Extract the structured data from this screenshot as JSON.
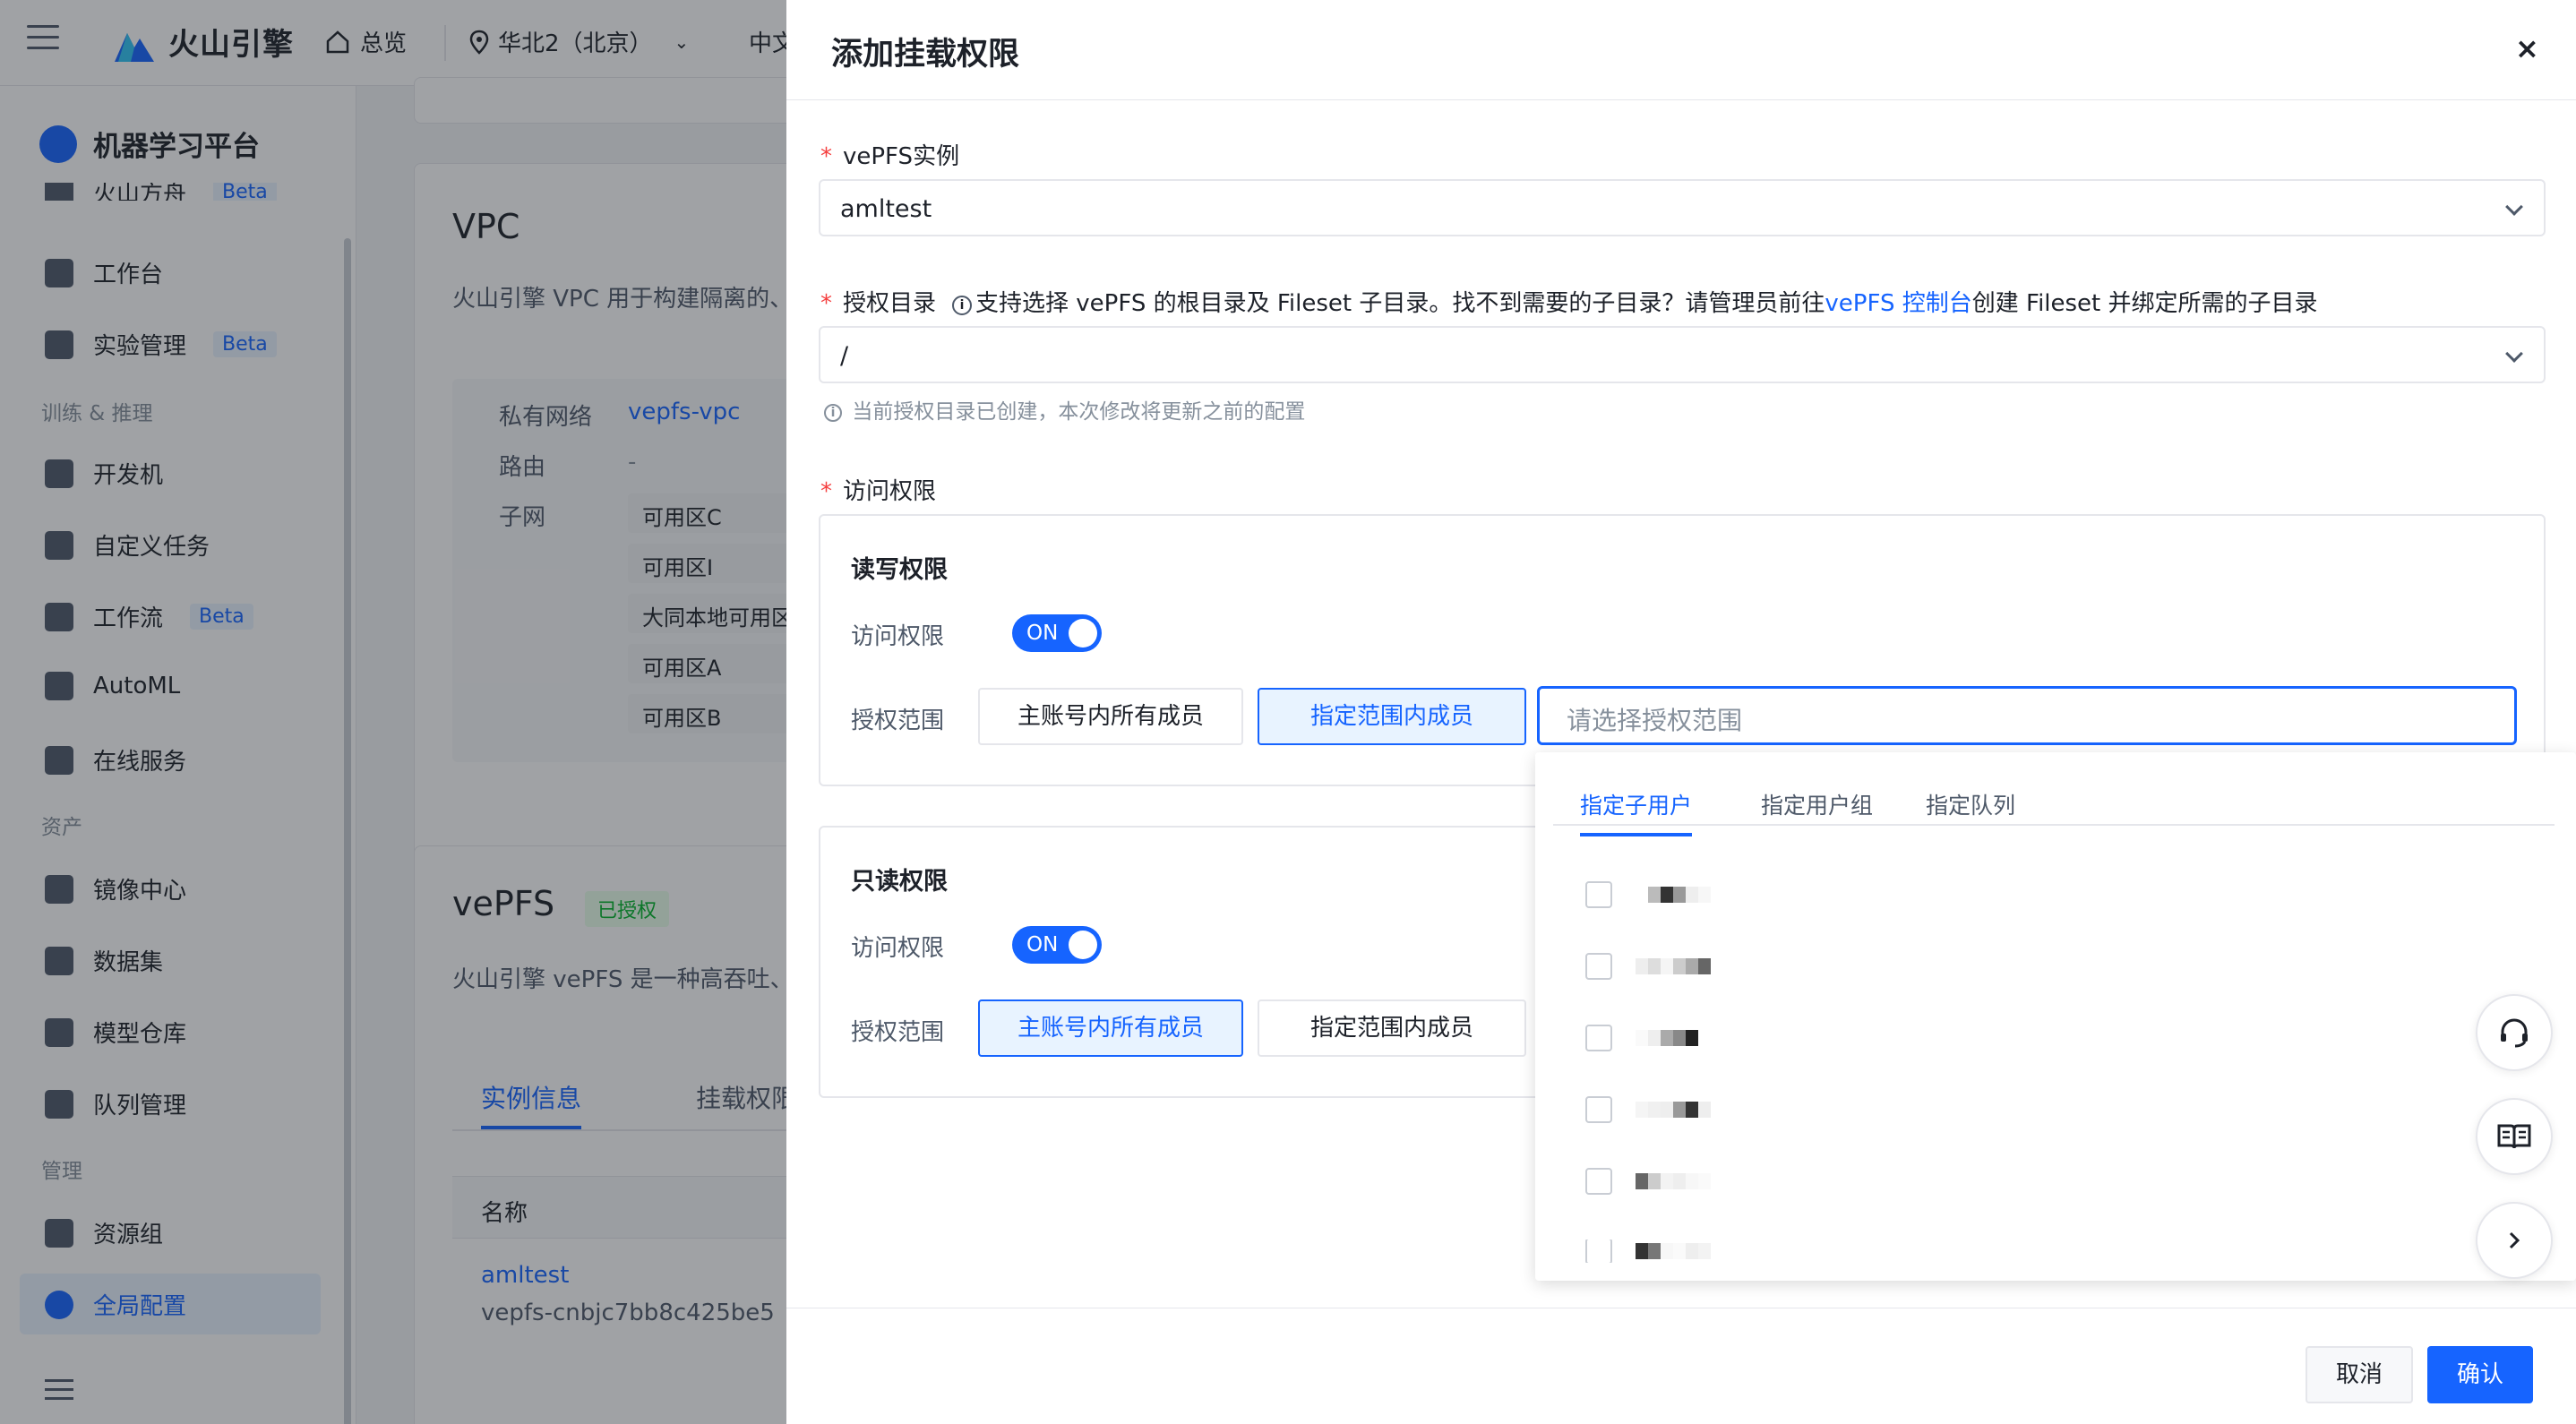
{
  "topbar": {
    "brand": "火山引擎",
    "home": "总览",
    "region": "华北2（北京）",
    "lang": "中文"
  },
  "sidebar": {
    "title": "机器学习平台",
    "items": [
      {
        "label": "火山方舟",
        "beta": "Beta"
      },
      {
        "label": "工作台"
      },
      {
        "label": "实验管理",
        "beta": "Beta"
      },
      {
        "label": "开发机"
      },
      {
        "label": "自定义任务"
      },
      {
        "label": "工作流",
        "beta": "Beta"
      },
      {
        "label": "AutoML"
      },
      {
        "label": "在线服务"
      },
      {
        "label": "镜像中心"
      },
      {
        "label": "数据集"
      },
      {
        "label": "模型仓库"
      },
      {
        "label": "队列管理"
      },
      {
        "label": "资源组"
      },
      {
        "label": "全局配置"
      }
    ],
    "groups": [
      "训练 & 推理",
      "资产",
      "管理"
    ]
  },
  "vpc": {
    "title": "VPC",
    "desc": "火山引擎 VPC 用于构建隔离的、",
    "rows": [
      {
        "key": "私有网络",
        "value": "vepfs-vpc"
      },
      {
        "key": "路由",
        "value": "-"
      },
      {
        "key": "子网",
        "value": ""
      }
    ],
    "zones": [
      "可用区C",
      "可用区I",
      "大同本地可用区",
      "可用区A",
      "可用区B"
    ]
  },
  "vepfs": {
    "title": "vePFS",
    "badge": "已授权",
    "desc": "火山引擎 vePFS 是一种高吞吐、",
    "tabs": [
      "实例信息",
      "挂载权限"
    ],
    "table_header": "名称",
    "instance_name": "amltest",
    "instance_id": "vepfs-cnbjc7bb8c425be5"
  },
  "drawer": {
    "title": "添加挂载权限",
    "close": "×",
    "instance_label": "vePFS实例",
    "instance_value": "amltest",
    "dir_label": "授权目录",
    "dir_hint_pre": "支持选择 vePFS 的根目录及 Fileset 子目录。找不到需要的子目录？请管理员前往",
    "dir_hint_link": "vePFS 控制台",
    "dir_hint_post": "创建 Fileset 并绑定所需的子目录",
    "dir_value": "/",
    "dir_helper": "当前授权目录已创建，本次修改将更新之前的配置",
    "access_label": "访问权限",
    "rw": {
      "title": "读写权限",
      "access": "访问权限",
      "switch": "ON",
      "scope": "授权范围",
      "opt_all": "主账号内所有成员",
      "opt_specific": "指定范围内成员",
      "placeholder": "请选择授权范围"
    },
    "ro": {
      "title": "只读权限",
      "access": "访问权限",
      "switch": "ON",
      "scope": "授权范围",
      "opt_all": "主账号内所有成员",
      "opt_specific": "指定范围内成员"
    },
    "dropdown_tabs": [
      "指定子用户",
      "指定用户组",
      "指定队列"
    ],
    "cancel": "取消",
    "confirm": "确认"
  },
  "colors": {
    "primary": "#1664ff",
    "required": "#f53f3f",
    "success": "#00b42a"
  }
}
